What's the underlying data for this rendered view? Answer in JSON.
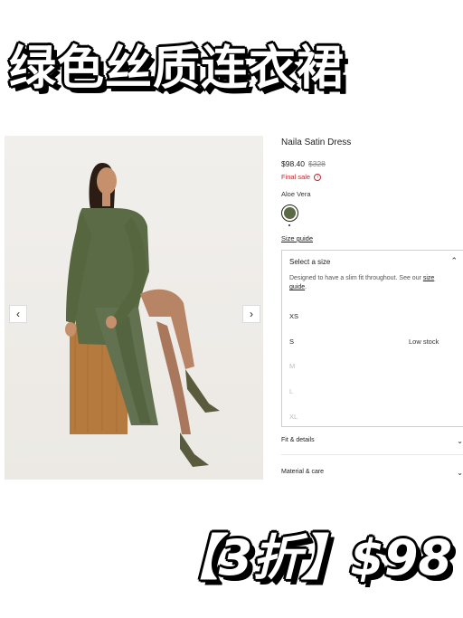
{
  "banner": {
    "headline": "绿色丝质连衣裙",
    "price_text": "【3折】$98"
  },
  "product": {
    "name": "Naila Satin Dress",
    "price": "$98.40",
    "original_price": "$328",
    "final_sale": "Final sale",
    "info_icon_glyph": "i",
    "color_name": "Aloe Vera",
    "swatch_color": "#5b6b46",
    "size_guide_link": "Size guide"
  },
  "size_selector": {
    "title": "Select a size",
    "chevron": "⌃",
    "description": "Designed to have a slim fit throughout. See our",
    "description_link": "size guide",
    "description_end": ".",
    "sizes": [
      {
        "label": "XS",
        "available": true,
        "note": ""
      },
      {
        "label": "S",
        "available": true,
        "note": "Low stock"
      },
      {
        "label": "M",
        "available": false,
        "note": ""
      },
      {
        "label": "L",
        "available": false,
        "note": ""
      },
      {
        "label": "XL",
        "available": false,
        "note": ""
      }
    ]
  },
  "accordions": [
    {
      "label": "Fit & details",
      "chevron": "⌄"
    },
    {
      "label": "Material & care",
      "chevron": "⌄"
    }
  ],
  "carousel": {
    "prev_glyph": "‹",
    "next_glyph": "›"
  },
  "colors": {
    "dress": "#5b6b46",
    "pedestal": "#b57a3e",
    "sale_red": "#c0262d"
  }
}
